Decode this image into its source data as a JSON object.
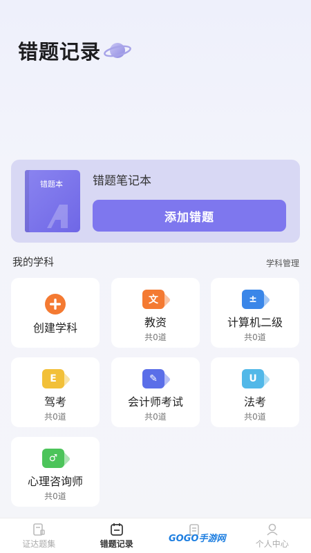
{
  "header": {
    "title": "错题记录"
  },
  "notebook": {
    "book_label": "错题本",
    "title": "错题笔记本",
    "add_button": "添加错题"
  },
  "subjects": {
    "section_title": "我的学科",
    "manage_label": "学科管理",
    "create_label": "创建学科",
    "items": [
      {
        "name": "教资",
        "count": "共0道",
        "glyph": "文",
        "color": "#f47a32"
      },
      {
        "name": "计算机二级",
        "count": "共0道",
        "glyph": "±",
        "color": "#3a86e8"
      },
      {
        "name": "驾考",
        "count": "共0道",
        "glyph": "E",
        "color": "#f2c038"
      },
      {
        "name": "会计师考试",
        "count": "共0道",
        "glyph": "✎",
        "color": "#5a6ee8"
      },
      {
        "name": "法考",
        "count": "共0道",
        "glyph": "U",
        "color": "#52b8e8"
      },
      {
        "name": "心理咨询师",
        "count": "共0道",
        "glyph": "♂",
        "color": "#4cc45a"
      }
    ]
  },
  "tabbar": {
    "tabs": [
      {
        "label": "证达题集",
        "icon": "book-icon"
      },
      {
        "label": "错题记录",
        "icon": "calendar-icon"
      },
      {
        "label": "",
        "icon": "clipboard-icon"
      },
      {
        "label": "个人中心",
        "icon": "person-icon"
      }
    ]
  },
  "watermark": "GOGO手游网"
}
